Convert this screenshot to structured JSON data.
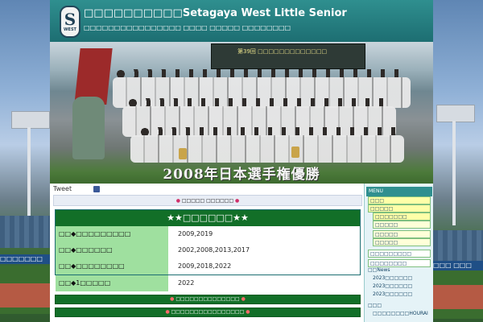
{
  "header": {
    "title": "□□□□□□□□□□Setagaya West Little Senior",
    "subtitle": "□□□□□□□□□□□□□□□□ □□□□ □□□□□ □□□□□□□□",
    "logo_letter": "S",
    "logo_text": "WEST",
    "colors": {
      "header": "#1d6e72",
      "accent": "#126f28",
      "highlight": "#9fe09f"
    }
  },
  "hero": {
    "caption": "2008年日本選手権優勝",
    "scoreboard_text": "第39回 □□□□□□□□□□□□□"
  },
  "social": {
    "tweet_label": "Tweet",
    "facebook_icon": "facebook-icon"
  },
  "notice": {
    "text": "□□□□□ □□□□□□"
  },
  "main": {
    "box_title": "★★□□□□□□★★",
    "rows": [
      {
        "label": "□□◆□□□□□□□□□",
        "value": "2009,2019"
      },
      {
        "label": "□□◆□□□□□□",
        "value": "2002,2008,2013,2017"
      },
      {
        "label": "□□◆□□□□□□□□",
        "value": "2009,2018,2022"
      },
      {
        "label": "□□◆1□□□□□",
        "value": "2022"
      }
    ],
    "section_bars": [
      "□□□□□□□□□□□□□□",
      "□□□□□□□□□□□□□□□□"
    ]
  },
  "sidebar": {
    "menu_label": "MENU",
    "items": [
      {
        "label": "□□□",
        "level": 1
      },
      {
        "label": "□□□□□",
        "level": 1
      },
      {
        "label": "□□□□□□□",
        "level": 2
      },
      {
        "label": "□□□□□",
        "level": 3
      },
      {
        "label": "□□□□□",
        "level": 3
      },
      {
        "label": "□□□□□",
        "level": 3
      },
      {
        "label": "□□□□□□□□□",
        "level": 1
      },
      {
        "label": "□□□□□□□□",
        "level": 1
      }
    ],
    "news_label": "□□News",
    "news_items": [
      "2023□□□□□□",
      "2023□□□□□□",
      "2023□□□□□□"
    ],
    "footer_label": "□□□",
    "footer_item": "□□□□□□□□HOURAI"
  }
}
